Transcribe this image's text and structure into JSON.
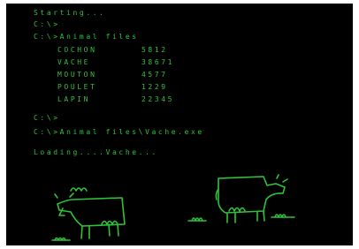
{
  "colors": {
    "background": "#000000",
    "phosphor": "#2fc23a"
  },
  "terminal": {
    "line1": "Starting...",
    "line2": "C:\\>",
    "line3": "C:\\>Animal files",
    "table": [
      {
        "name": "COCHON",
        "value": "5812"
      },
      {
        "name": "VACHE",
        "value": "38671"
      },
      {
        "name": "MOUTON",
        "value": "4577"
      },
      {
        "name": "POULET",
        "value": "1229"
      },
      {
        "name": "LAPIN",
        "value": "22345"
      }
    ],
    "line4": "C:\\>",
    "line5": "C:\\>Animal files\\Vache.exe",
    "line6": "Loading....Vache..."
  },
  "illustration": {
    "cows": [
      "cow-left",
      "cow-right"
    ],
    "grass": [
      "grass-tuft",
      "grass-tuft",
      "grass-tuft"
    ]
  }
}
